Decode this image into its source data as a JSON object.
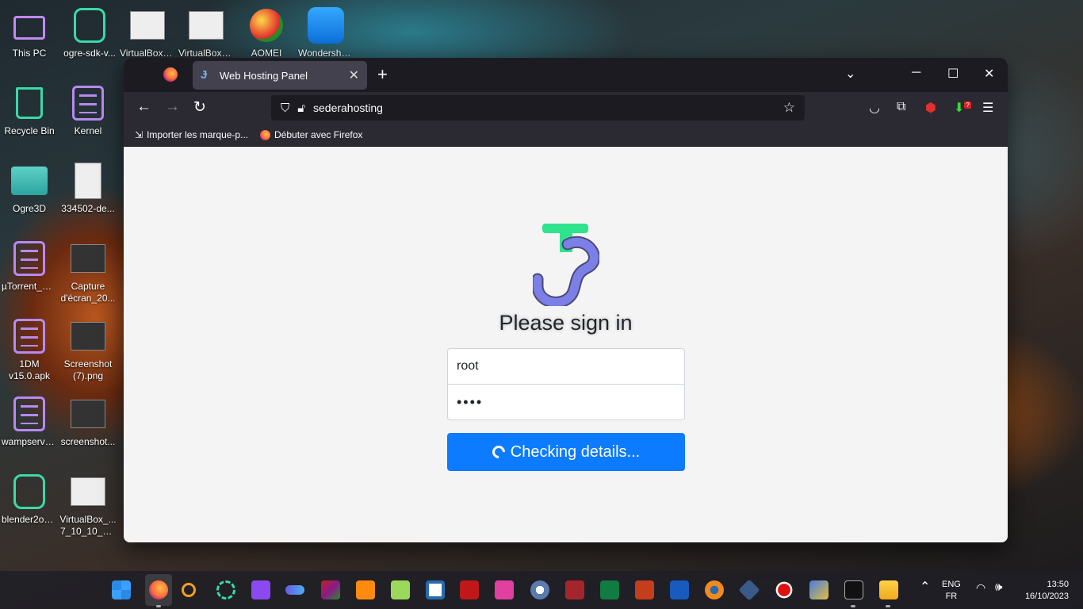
{
  "desktop": {
    "icons": [
      {
        "label": "This PC"
      },
      {
        "label": "ogre-sdk-v..."
      },
      {
        "label": "VirtualBox_..."
      },
      {
        "label": "VirtualBox_..."
      },
      {
        "label": "AOMEI"
      },
      {
        "label": "Wondershare"
      },
      {
        "label": "Recycle Bin"
      },
      {
        "label": "Kernel"
      },
      {
        "label": "Ogre3D"
      },
      {
        "label": "334502-de..."
      },
      {
        "label": "µTorrent_V3..."
      },
      {
        "label": "Capture",
        "label2": "d'écran_20..."
      },
      {
        "label": "1DM",
        "label2": "v15.0.apk"
      },
      {
        "label": "Screenshot",
        "label2": "(7).png"
      },
      {
        "label": "wampserve..."
      },
      {
        "label": "screenshot..."
      },
      {
        "label": "blender2og..."
      },
      {
        "label": "VirtualBox_...",
        "label2": "7_10_10_20..."
      }
    ]
  },
  "browser": {
    "tab_title": "Web Hosting Panel",
    "tab_favicon": "Ɉ",
    "url": "sederahosting",
    "bookmarks": [
      {
        "label": "Importer les marque-p...",
        "icon": "import-icon"
      },
      {
        "label": "Débuter avec Firefox",
        "icon": "firefox-icon"
      }
    ],
    "extension_badge": "?"
  },
  "page": {
    "heading": "Please sign in",
    "username_value": "root",
    "password_value": "••••",
    "submit_label": "Checking details..."
  },
  "taskbar": {
    "language_top": "ENG",
    "language_bottom": "FR",
    "time": "13:50",
    "date": "16/10/2023"
  },
  "colors": {
    "accent_button": "#0d7bff",
    "logo_green": "#2ee38c",
    "logo_purple": "#7b7fe6"
  }
}
